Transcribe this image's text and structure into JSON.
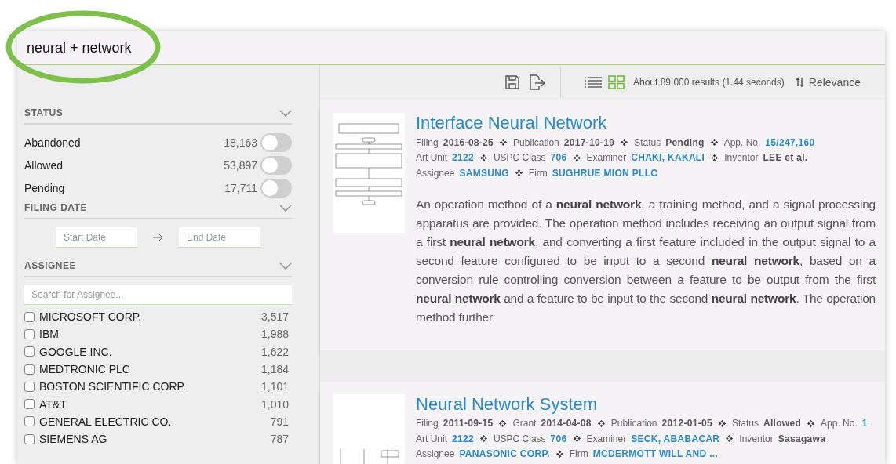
{
  "search": {
    "query": "neural + network"
  },
  "sidebar": {
    "sections": [
      {
        "kind": "toggles",
        "title": "STATUS",
        "items": [
          {
            "label": "Abandoned",
            "count": "18,163",
            "on": false
          },
          {
            "label": "Allowed",
            "count": "53,897",
            "on": false
          },
          {
            "label": "Pending",
            "count": "17,711",
            "on": false
          }
        ]
      },
      {
        "kind": "dates",
        "title": "FILING DATE",
        "start_placeholder": "Start Date",
        "end_placeholder": "End Date"
      },
      {
        "kind": "checklist",
        "title": "ASSIGNEE",
        "placeholder": "Search for Assignee...",
        "items": [
          {
            "label": "MICROSOFT CORP.",
            "count": "3,517",
            "checked": false
          },
          {
            "label": "IBM",
            "count": "1,988",
            "checked": false
          },
          {
            "label": "GOOGLE INC.",
            "count": "1,622",
            "checked": false
          },
          {
            "label": "MEDTRONIC PLC",
            "count": "1,184",
            "checked": false
          },
          {
            "label": "BOSTON SCIENTIFIC CORP.",
            "count": "1,101",
            "checked": false
          },
          {
            "label": "AT&T",
            "count": "1,010",
            "checked": false
          },
          {
            "label": "GENERAL ELECTRIC CO.",
            "count": "791",
            "checked": false
          },
          {
            "label": "SIEMENS AG",
            "count": "787",
            "checked": false
          }
        ]
      }
    ]
  },
  "toolbar": {
    "views": [
      {
        "kind": "list",
        "selected": false
      },
      {
        "kind": "grid",
        "selected": true
      }
    ],
    "results_text": "About 89,000 results (1.44 seconds)",
    "sort": "Relevance"
  },
  "results": [
    {
      "title": "Interface Neural Network",
      "meta_lines": [
        [
          {
            "label": "Filing",
            "value": "2016-08-25",
            "kind": "bold"
          },
          {
            "label": "Publication",
            "value": "2017-10-19",
            "kind": "bold"
          },
          {
            "label": "Status",
            "value": "Pending",
            "kind": "bold"
          },
          {
            "label": "App. No.",
            "value": "15/247,160",
            "kind": "link"
          }
        ],
        [
          {
            "label": "Art Unit",
            "value": "2122",
            "kind": "link"
          },
          {
            "label": "USPC Class",
            "value": "706",
            "kind": "link"
          },
          {
            "label": "Examiner",
            "value": "CHAKI, KAKALI",
            "kind": "link"
          },
          {
            "label": "Inventor",
            "value": "LEE et al.",
            "kind": "bold"
          }
        ],
        [
          {
            "label": "Assignee",
            "value": "SAMSUNG",
            "kind": "link"
          },
          {
            "label": "Firm",
            "value": "SUGHRUE MION PLLC",
            "kind": "link"
          }
        ]
      ],
      "abstract": "An operation method of a **neural network**, a training method, and a signal processing apparatus are provided. The operation method includes receiving an output signal from a first **neural network**, and converting a first feature included in the output signal to a second feature configured to be input to a second **neural network**, based on a conversion rule controlling conversion between a feature to be output from the first **neural network** and a feature to be input to the second **neural network**. The operation method further"
    },
    {
      "title": "Neural Network System",
      "meta_lines": [
        [
          {
            "label": "Filing",
            "value": "2011-09-15",
            "kind": "bold"
          },
          {
            "label": "Grant",
            "value": "2014-04-08",
            "kind": "bold"
          },
          {
            "label": "Publication",
            "value": "2012-01-05",
            "kind": "bold"
          },
          {
            "label": "Status",
            "value": "Allowed",
            "kind": "bold"
          },
          {
            "label": "App. No.",
            "value": "1",
            "kind": "link"
          }
        ],
        [
          {
            "label": "Art Unit",
            "value": "2122",
            "kind": "link"
          },
          {
            "label": "USPC Class",
            "value": "706",
            "kind": "link"
          },
          {
            "label": "Examiner",
            "value": "SECK, ABABACAR",
            "kind": "link"
          },
          {
            "label": "Inventor",
            "value": "Sasagawa",
            "kind": "bold"
          }
        ],
        [
          {
            "label": "Assignee",
            "value": "PANASONIC CORP.",
            "kind": "link"
          },
          {
            "label": "Firm",
            "value": "MCDERMOTT WILL AND ...",
            "kind": "link"
          }
        ]
      ]
    }
  ]
}
